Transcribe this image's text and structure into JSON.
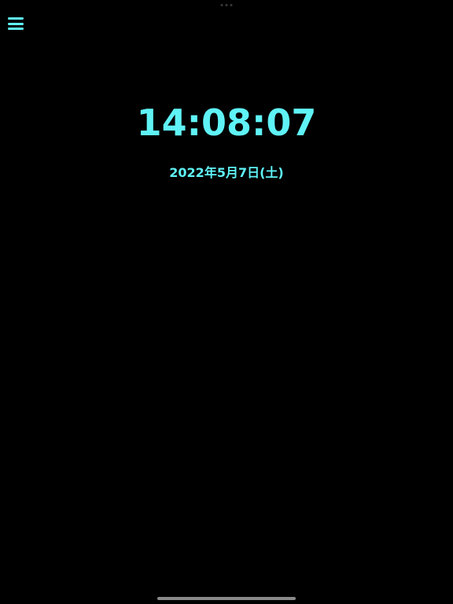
{
  "colors": {
    "background": "#000000",
    "accent": "#5ff3f6"
  },
  "menu": {
    "icon": "hamburger-menu-icon"
  },
  "clock": {
    "time": "14:08:07",
    "date": "2022年5月7日(土)"
  }
}
